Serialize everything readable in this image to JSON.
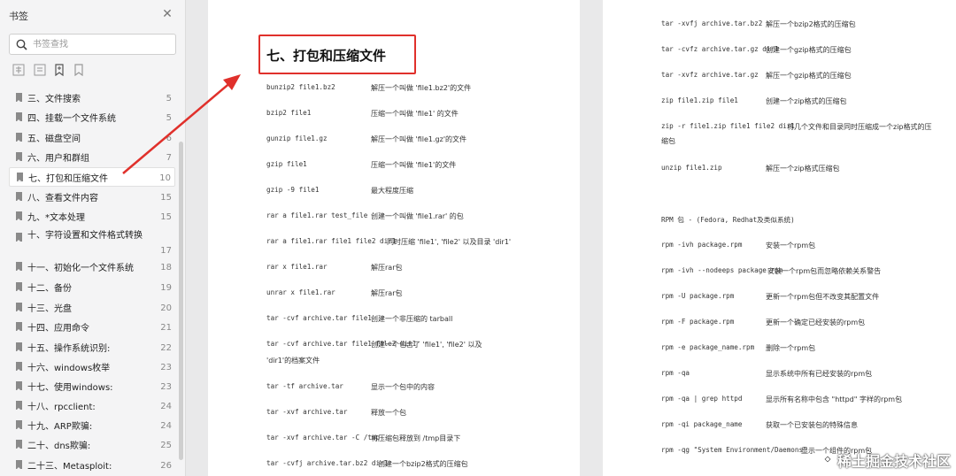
{
  "sidebar": {
    "title": "书签",
    "search_placeholder": "书签查找",
    "items": [
      {
        "label": "三、文件搜索",
        "page": "5"
      },
      {
        "label": "四、挂载一个文件系统",
        "page": "5"
      },
      {
        "label": "五、磁盘空间",
        "page": "6"
      },
      {
        "label": "六、用户和群组",
        "page": "7"
      },
      {
        "label": "七、打包和压缩文件",
        "page": "10"
      },
      {
        "label": "八、查看文件内容",
        "page": "15"
      },
      {
        "label": "九、*文本处理",
        "page": "15"
      },
      {
        "label": "十、字符设置和文件格式转换",
        "page": "17"
      },
      {
        "label": "十一、初始化一个文件系统",
        "page": "18"
      },
      {
        "label": "十二、备份",
        "page": "19"
      },
      {
        "label": "十三、光盘",
        "page": "20"
      },
      {
        "label": "十四、应用命令",
        "page": "21"
      },
      {
        "label": "十五、操作系统识别:",
        "page": "22"
      },
      {
        "label": "十六、windows枚举",
        "page": "23"
      },
      {
        "label": "十七、使用windows:",
        "page": "23"
      },
      {
        "label": "十八、rpcclient:",
        "page": "24"
      },
      {
        "label": "十九、ARP欺骗:",
        "page": "24"
      },
      {
        "label": "二十、dns欺骗:",
        "page": "25"
      },
      {
        "label": "二十三、Metasploit:",
        "page": "26"
      }
    ]
  },
  "left_page": {
    "heading": "七、打包和压缩文件",
    "rows": [
      {
        "cmd": "bunzip2 file1.bz2",
        "desc": "解压一个叫做 'file1.bz2'的文件"
      },
      {
        "cmd": "bzip2 file1",
        "desc": "压缩一个叫做 'file1' 的文件"
      },
      {
        "cmd": "gunzip file1.gz",
        "desc": "解压一个叫做 'file1.gz'的文件"
      },
      {
        "cmd": "gzip file1",
        "desc": "压缩一个叫做 'file1'的文件"
      },
      {
        "cmd": "gzip -9 file1",
        "desc": "最大程度压缩"
      },
      {
        "cmd": "rar a file1.rar test_file",
        "desc": "创建一个叫做 'file1.rar' 的包"
      },
      {
        "cmd": "rar a file1.rar file1 file2 dir1",
        "desc": "同时压缩 'file1', 'file2' 以及目录 'dir1'"
      },
      {
        "cmd": "rar x file1.rar",
        "desc": "解压rar包"
      },
      {
        "cmd": "unrar x file1.rar",
        "desc": "解压rar包"
      },
      {
        "cmd": "tar -cvf archive.tar file1",
        "desc": "创建一个非压缩的 tarball"
      },
      {
        "cmd": "tar -cvf archive.tar file1 file2 dir1",
        "desc": "创建一个包含了 'file1', 'file2' 以及",
        "desc2": "'dir1'的档案文件"
      },
      {
        "cmd": "tar -tf archive.tar",
        "desc": "显示一个包中的内容"
      },
      {
        "cmd": "tar -xvf archive.tar",
        "desc": "释放一个包"
      },
      {
        "cmd": "tar -xvf archive.tar -C /tmp",
        "desc": "将压缩包释放到 /tmp目录下"
      },
      {
        "cmd": "tar -cvfj archive.tar.bz2 dir1",
        "desc": "创建一个bzip2格式的压缩包"
      }
    ]
  },
  "right_page": {
    "rows": [
      {
        "cmd": "tar -xvfj archive.tar.bz2",
        "desc": "解压一个bzip2格式的压缩包"
      },
      {
        "cmd": "tar -cvfz archive.tar.gz dir1",
        "desc": "创建一个gzip格式的压缩包"
      },
      {
        "cmd": "tar -xvfz archive.tar.gz",
        "desc": "解压一个gzip格式的压缩包"
      },
      {
        "cmd": "zip file1.zip file1",
        "desc": "创建一个zip格式的压缩包"
      },
      {
        "cmd": "zip -r file1.zip file1 file2 dir1",
        "desc": "将几个文件和目录同时压缩成一个zip格式的压",
        "desc2": "缩包"
      },
      {
        "cmd": "unzip file1.zip",
        "desc": "解压一个zip格式压缩包"
      },
      {
        "cmd": "RPM 包 - (Fedora, Redhat及类似系统)",
        "desc": ""
      },
      {
        "cmd": "rpm -ivh package.rpm",
        "desc": "安装一个rpm包"
      },
      {
        "cmd": "rpm -ivh --nodeeps package.rpm",
        "desc": "安装一个rpm包而忽略依赖关系警告"
      },
      {
        "cmd": "rpm -U package.rpm",
        "desc": "更新一个rpm包但不改变其配置文件"
      },
      {
        "cmd": "rpm -F package.rpm",
        "desc": "更新一个确定已经安装的rpm包"
      },
      {
        "cmd": "rpm -e package_name.rpm",
        "desc": "删除一个rpm包"
      },
      {
        "cmd": "rpm -qa",
        "desc": "显示系统中所有已经安装的rpm包"
      },
      {
        "cmd": "rpm -qa | grep httpd",
        "desc": "显示所有名称中包含 \"httpd\" 字样的rpm包"
      },
      {
        "cmd": "rpm -qi package_name",
        "desc": "获取一个已安装包的特殊信息"
      },
      {
        "cmd": "rpm -qg \"System Environment/Daemons\"",
        "desc": "显示一个组件的rpm包"
      }
    ]
  },
  "watermark": "稀土掘金技术社区",
  "colors": {
    "highlight": "#e0302b",
    "sidebar_bg": "#f4f4f5"
  }
}
